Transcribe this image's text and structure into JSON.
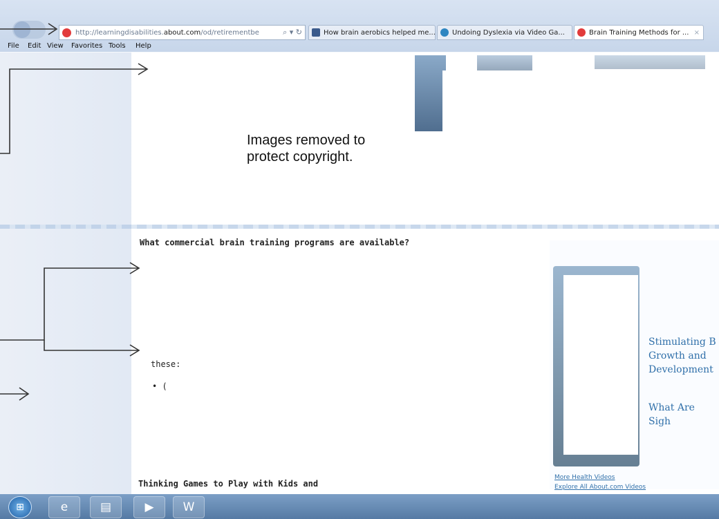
{
  "browser": {
    "url_prefix": "http://learningdisabilities.",
    "url_domain": "about.com",
    "url_rest": "/od/retirementbe",
    "addr_icons": "⌕ ▾ ↻",
    "tabs": [
      {
        "label": "How brain aerobics helped me...",
        "icon_color": "#3b5b8c"
      },
      {
        "label": "Undoing Dyslexia via Video Ga...",
        "icon_color": "#2e86c1"
      },
      {
        "label": "Brain Training Methods for ...",
        "icon_color": "#e23b3b"
      }
    ],
    "tab_close": "×"
  },
  "menu": [
    "File",
    "Edit",
    "View",
    "Favorites",
    "Tools",
    "Help"
  ],
  "article": {
    "copyright_note_line1": "Images removed to",
    "copyright_note_line2": "protect copyright.",
    "question_heading": "What commercial brain training programs are available?",
    "fragment_these": "these:",
    "bullet_fragment": "• (",
    "next_heading": "Thinking Games to Play with Kids and"
  },
  "sidebar": {
    "link1_line1": "Stimulating B",
    "link1_line2": "Growth and",
    "link1_line3": "Development",
    "link2": "What Are Sigh",
    "more_videos": "More Health Videos",
    "explore_videos": "Explore All About.com Videos"
  },
  "taskbar": {
    "apps": [
      {
        "name": "ie",
        "glyph": "e"
      },
      {
        "name": "explorer",
        "glyph": "▤"
      },
      {
        "name": "media",
        "glyph": "▶"
      },
      {
        "name": "word",
        "glyph": "W"
      }
    ]
  }
}
